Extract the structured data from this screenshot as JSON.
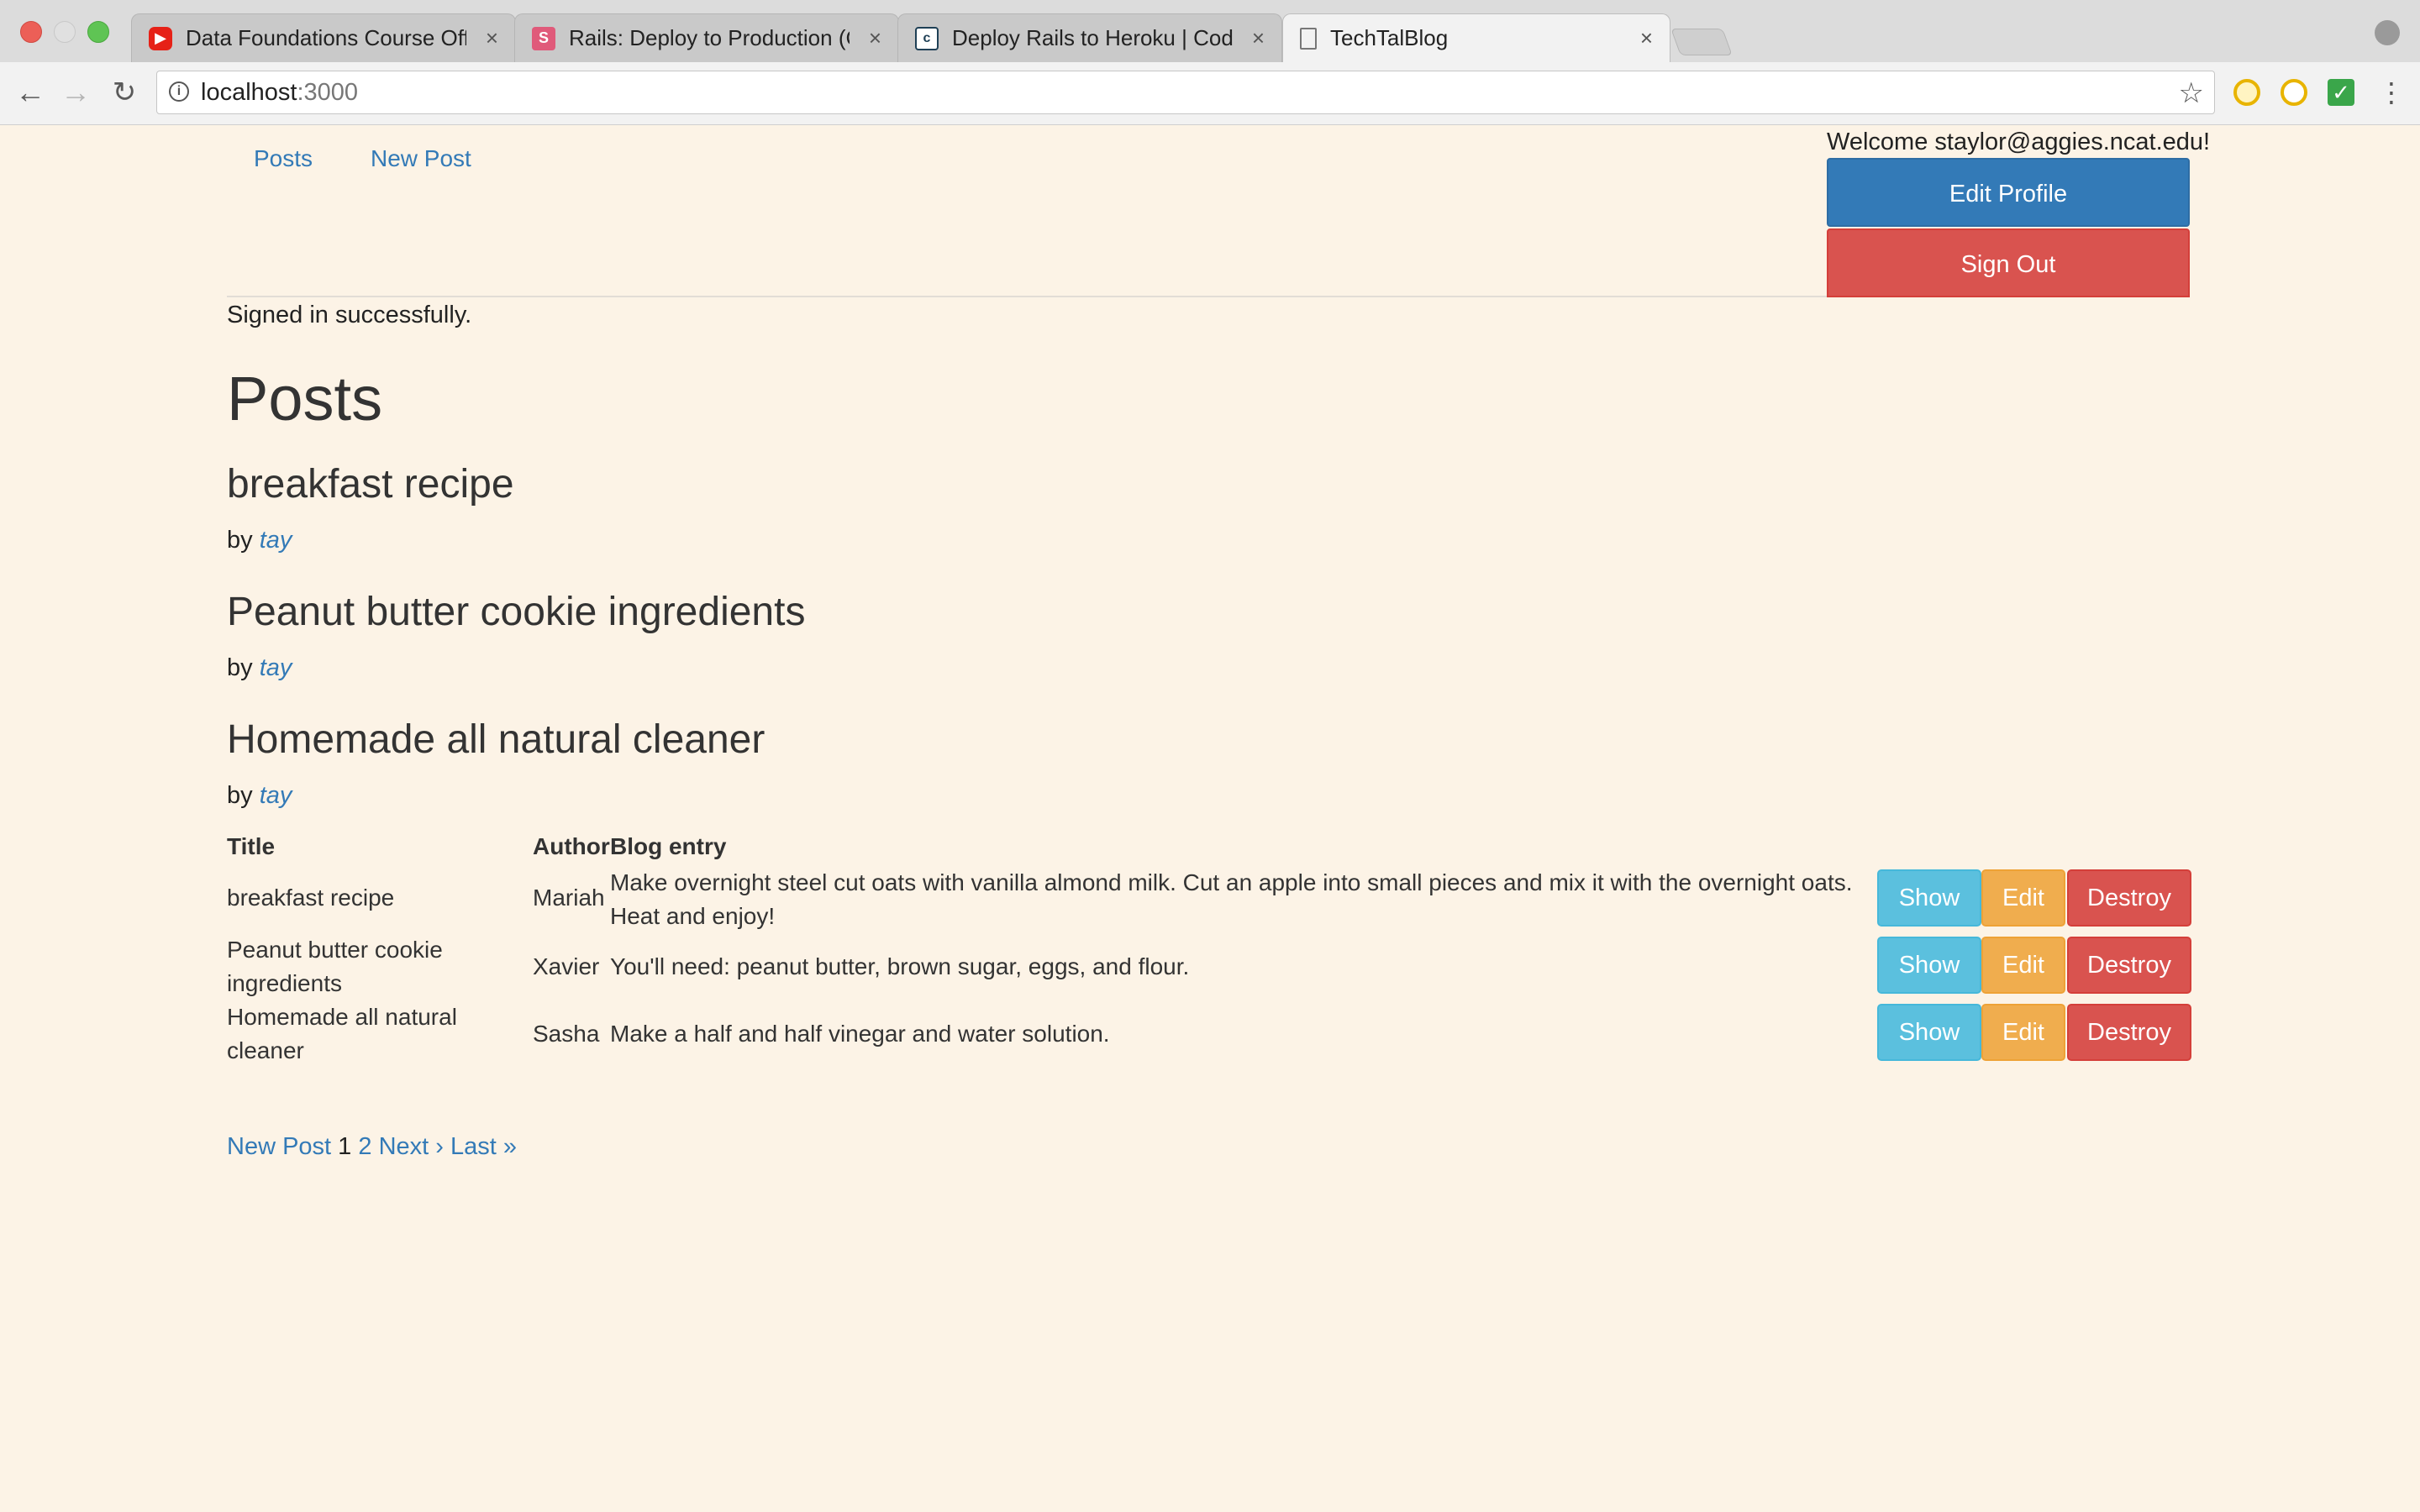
{
  "browser": {
    "tabs": [
      {
        "title": "Data Foundations Course Offic",
        "icon": "youtube-icon"
      },
      {
        "title": "Rails: Deploy to Production (Cc",
        "icon": "s-icon"
      },
      {
        "title": "Deploy Rails to Heroku | Codec",
        "icon": "codecademy-icon"
      },
      {
        "title": "TechTalBlog",
        "icon": "document-icon",
        "active": true
      }
    ],
    "close_glyph": "×",
    "url_host": "localhost",
    "url_port": ":3000"
  },
  "nav": {
    "posts_link": "Posts",
    "new_post_link": "New Post"
  },
  "user": {
    "welcome": "Welcome staylor@aggies.ncat.edu!",
    "edit_profile": "Edit Profile",
    "sign_out": "Sign Out"
  },
  "flash": "Signed in successfully.",
  "heading": "Posts",
  "posts": [
    {
      "title": "breakfast recipe",
      "by": "by",
      "author": "tay"
    },
    {
      "title": "Peanut butter cookie ingredients",
      "by": "by",
      "author": "tay"
    },
    {
      "title": "Homemade all natural cleaner",
      "by": "by",
      "author": "tay"
    }
  ],
  "table": {
    "headers": {
      "title": "Title",
      "author": "Author",
      "entry": "Blog entry"
    },
    "rows": [
      {
        "title": "breakfast recipe",
        "author": "Mariah",
        "entry": "Make overnight steel cut oats with vanilla almond milk. Cut an apple into small pieces and mix it with the overnight oats. Heat and enjoy!"
      },
      {
        "title": "Peanut butter cookie ingredients",
        "author": "Xavier",
        "entry": "You'll need: peanut butter, brown sugar, eggs, and flour."
      },
      {
        "title": "Homemade all natural cleaner",
        "author": "Sasha",
        "entry": "Make a half and half vinegar and water solution."
      }
    ],
    "actions": {
      "show": "Show",
      "edit": "Edit",
      "destroy": "Destroy"
    }
  },
  "pager": {
    "new_post": "New Post",
    "current": "1",
    "page2": "2",
    "next": "Next ›",
    "last": "Last »"
  },
  "colors": {
    "page_bg": "#fcf3e6",
    "primary": "#337ab7",
    "danger": "#d9534f",
    "info": "#5bc0de",
    "warning": "#f0ad4e"
  }
}
